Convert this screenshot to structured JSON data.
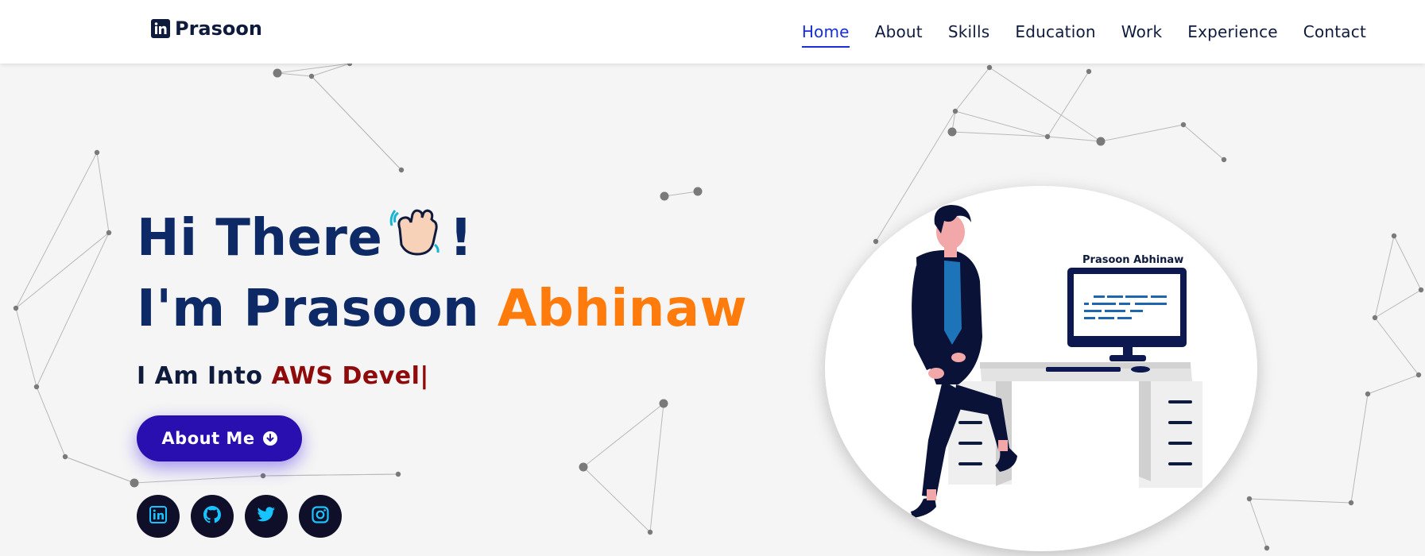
{
  "header": {
    "brand": "Prasoon",
    "brand_icon": "linkedin-square-icon",
    "nav": [
      {
        "label": "Home",
        "active": true
      },
      {
        "label": "About",
        "active": false
      },
      {
        "label": "Skills",
        "active": false
      },
      {
        "label": "Education",
        "active": false
      },
      {
        "label": "Work",
        "active": false
      },
      {
        "label": "Experience",
        "active": false
      },
      {
        "label": "Contact",
        "active": false
      }
    ]
  },
  "hero": {
    "greeting": "Hi There",
    "greeting_emoji": "waving-hand-icon",
    "greeting_suffix": "!",
    "intro_prefix": "I'm Prasoon",
    "intro_name_accent": "Abhinaw",
    "into_prefix": "I Am Into",
    "into_typed": "AWS Devel|",
    "cta_label": "About Me",
    "cta_icon": "arrow-down-circle-icon"
  },
  "socials": [
    {
      "name": "linkedin",
      "icon": "linkedin-icon"
    },
    {
      "name": "github",
      "icon": "github-icon"
    },
    {
      "name": "twitter",
      "icon": "twitter-icon"
    },
    {
      "name": "instagram",
      "icon": "instagram-icon"
    }
  ],
  "illustration": {
    "monitor_caption": "Prasoon Abhinaw"
  },
  "colors": {
    "nav_active": "#1a2ed6",
    "heading": "#0d2a66",
    "accent_orange": "#ff7b0b",
    "typed_red": "#8f0b0b",
    "button_bg": "#2a0fb0",
    "social_bg": "#0f0f29",
    "social_icon": "#18c4ff",
    "background": "#f5f5f5"
  }
}
